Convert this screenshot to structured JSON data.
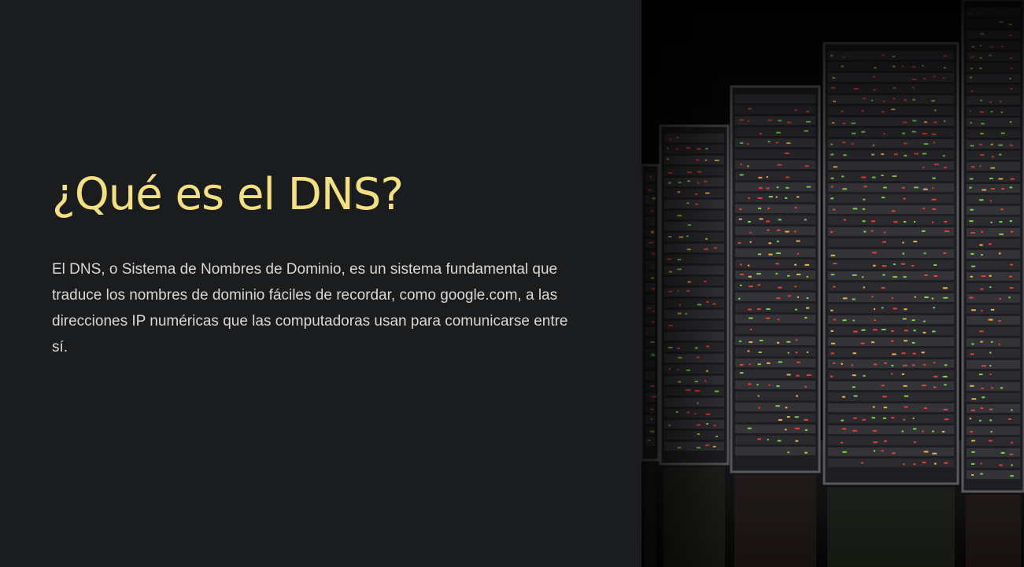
{
  "slide": {
    "title": "¿Qué es el DNS?",
    "body": "El DNS, o Sistema de Nombres de Dominio, es un sistema fundamental que traduce los nombres de dominio fáciles de recordar, como google.com, a las direcciones IP numéricas que las computadoras usan para comunicarse entre sí.",
    "image": "server-racks-photo"
  },
  "colors": {
    "background": "#1b1c1e",
    "title": "#f3e07f",
    "body": "#d8d8d8",
    "led_red": "#e0413a",
    "led_green": "#7fd04a",
    "led_amber": "#e9b44c"
  }
}
